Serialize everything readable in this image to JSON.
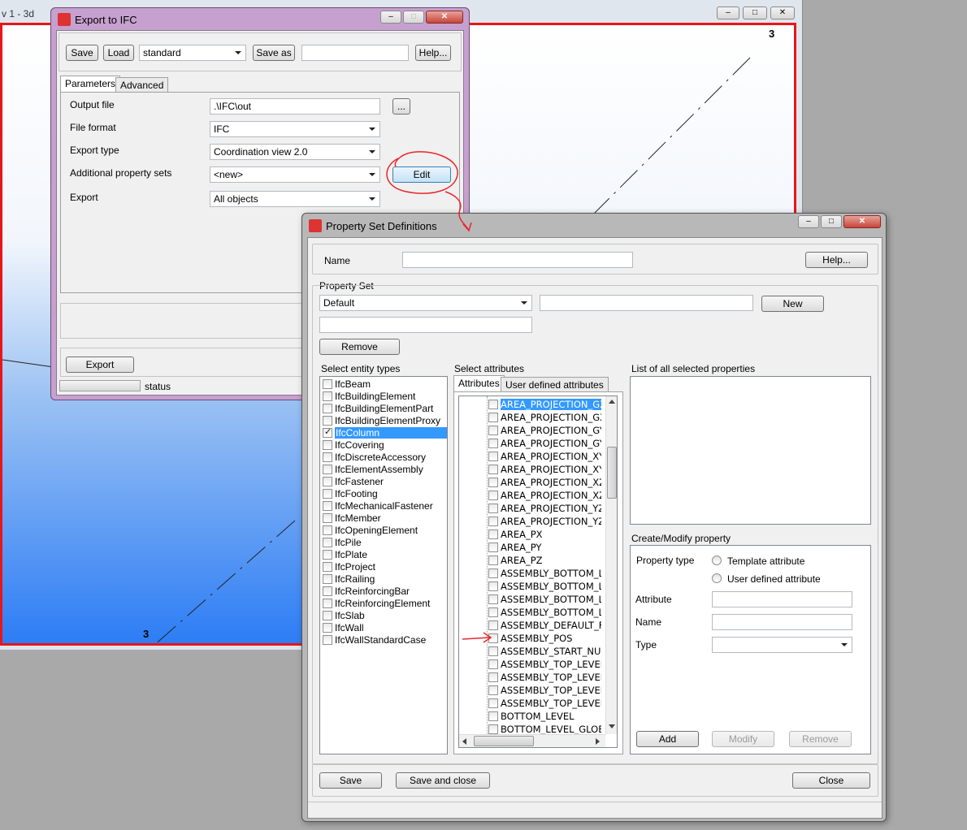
{
  "background": {
    "window_title_fragment": "v 1 - 3d",
    "grid_label_top": "3",
    "grid_label_bottom": "3"
  },
  "export_dialog": {
    "title": "Export to IFC",
    "toolbar": {
      "save_label": "Save",
      "load_label": "Load",
      "preset_value": "standard",
      "save_as_label": "Save as",
      "save_as_name_value": "",
      "help_label": "Help..."
    },
    "tabs": [
      "Parameters",
      "Advanced"
    ],
    "rows": [
      {
        "label": "Output file",
        "value": ".\\IFC\\out"
      },
      {
        "label": "File format",
        "value": "IFC"
      },
      {
        "label": "Export type",
        "value": "Coordination view 2.0"
      },
      {
        "label": "Additional property sets",
        "value": "<new>"
      },
      {
        "label": "Export",
        "value": "All objects"
      }
    ],
    "browse_label": "...",
    "edit_label": "Edit",
    "export_label": "Export",
    "status_label": "status"
  },
  "psd_dialog": {
    "title": "Property Set Definitions",
    "name_label": "Name",
    "name_value": "",
    "help_label": "Help...",
    "property_set_label": "Property Set",
    "property_set_value": "Default",
    "new_name_value": "",
    "new_label": "New",
    "second_name_value": "",
    "remove_label": "Remove",
    "entity_types_label": "Select entity types",
    "entity_types": [
      {
        "name": "IfcBeam",
        "checked": false
      },
      {
        "name": "IfcBuildingElement",
        "checked": false
      },
      {
        "name": "IfcBuildingElementPart",
        "checked": false
      },
      {
        "name": "IfcBuildingElementProxy",
        "checked": false
      },
      {
        "name": "IfcColumn",
        "checked": true
      },
      {
        "name": "IfcCovering",
        "checked": false
      },
      {
        "name": "IfcDiscreteAccessory",
        "checked": false
      },
      {
        "name": "IfcElementAssembly",
        "checked": false
      },
      {
        "name": "IfcFastener",
        "checked": false
      },
      {
        "name": "IfcFooting",
        "checked": false
      },
      {
        "name": "IfcMechanicalFastener",
        "checked": false
      },
      {
        "name": "IfcMember",
        "checked": false
      },
      {
        "name": "IfcOpeningElement",
        "checked": false
      },
      {
        "name": "IfcPile",
        "checked": false
      },
      {
        "name": "IfcPlate",
        "checked": false
      },
      {
        "name": "IfcProject",
        "checked": false
      },
      {
        "name": "IfcRailing",
        "checked": false
      },
      {
        "name": "IfcReinforcingBar",
        "checked": false
      },
      {
        "name": "IfcReinforcingElement",
        "checked": false
      },
      {
        "name": "IfcSlab",
        "checked": false
      },
      {
        "name": "IfcWall",
        "checked": false
      },
      {
        "name": "IfcWallStandardCase",
        "checked": false
      }
    ],
    "attributes_label": "Select attributes",
    "attr_tabs": [
      "Attributes",
      "User defined attributes"
    ],
    "attributes": [
      "AREA_PROJECTION_GX",
      "AREA_PROJECTION_GX",
      "AREA_PROJECTION_GY",
      "AREA_PROJECTION_GY",
      "AREA_PROJECTION_XY",
      "AREA_PROJECTION_XY",
      "AREA_PROJECTION_XZ",
      "AREA_PROJECTION_XZ",
      "AREA_PROJECTION_YZ",
      "AREA_PROJECTION_YZ",
      "AREA_PX",
      "AREA_PY",
      "AREA_PZ",
      "ASSEMBLY_BOTTOM_L",
      "ASSEMBLY_BOTTOM_L",
      "ASSEMBLY_BOTTOM_L",
      "ASSEMBLY_BOTTOM_L",
      "ASSEMBLY_DEFAULT_F",
      "ASSEMBLY_POS",
      "ASSEMBLY_START_NU",
      "ASSEMBLY_TOP_LEVEL",
      "ASSEMBLY_TOP_LEVEL",
      "ASSEMBLY_TOP_LEVEL",
      "ASSEMBLY_TOP_LEVEL",
      "BOTTOM_LEVEL",
      "BOTTOM_LEVEL_GLOBA"
    ],
    "selected_list_label": "List of all selected properties",
    "create_modify_label": "Create/Modify property",
    "property_type_label": "Property type",
    "template_attribute_label": "Template attribute",
    "user_defined_attribute_label": "User defined attribute",
    "attribute_label": "Attribute",
    "attribute_value": "",
    "name2_label": "Name",
    "name2_value": "",
    "type_label": "Type",
    "type_value": "",
    "add_label": "Add",
    "modify_label": "Modify",
    "remove2_label": "Remove",
    "save_label": "Save",
    "save_close_label": "Save and close",
    "close_label": "Close"
  },
  "colors": {
    "annotation_red": "#e8262b",
    "viewport_blue": "#2a7fff",
    "selection_blue": "#3399ff"
  }
}
